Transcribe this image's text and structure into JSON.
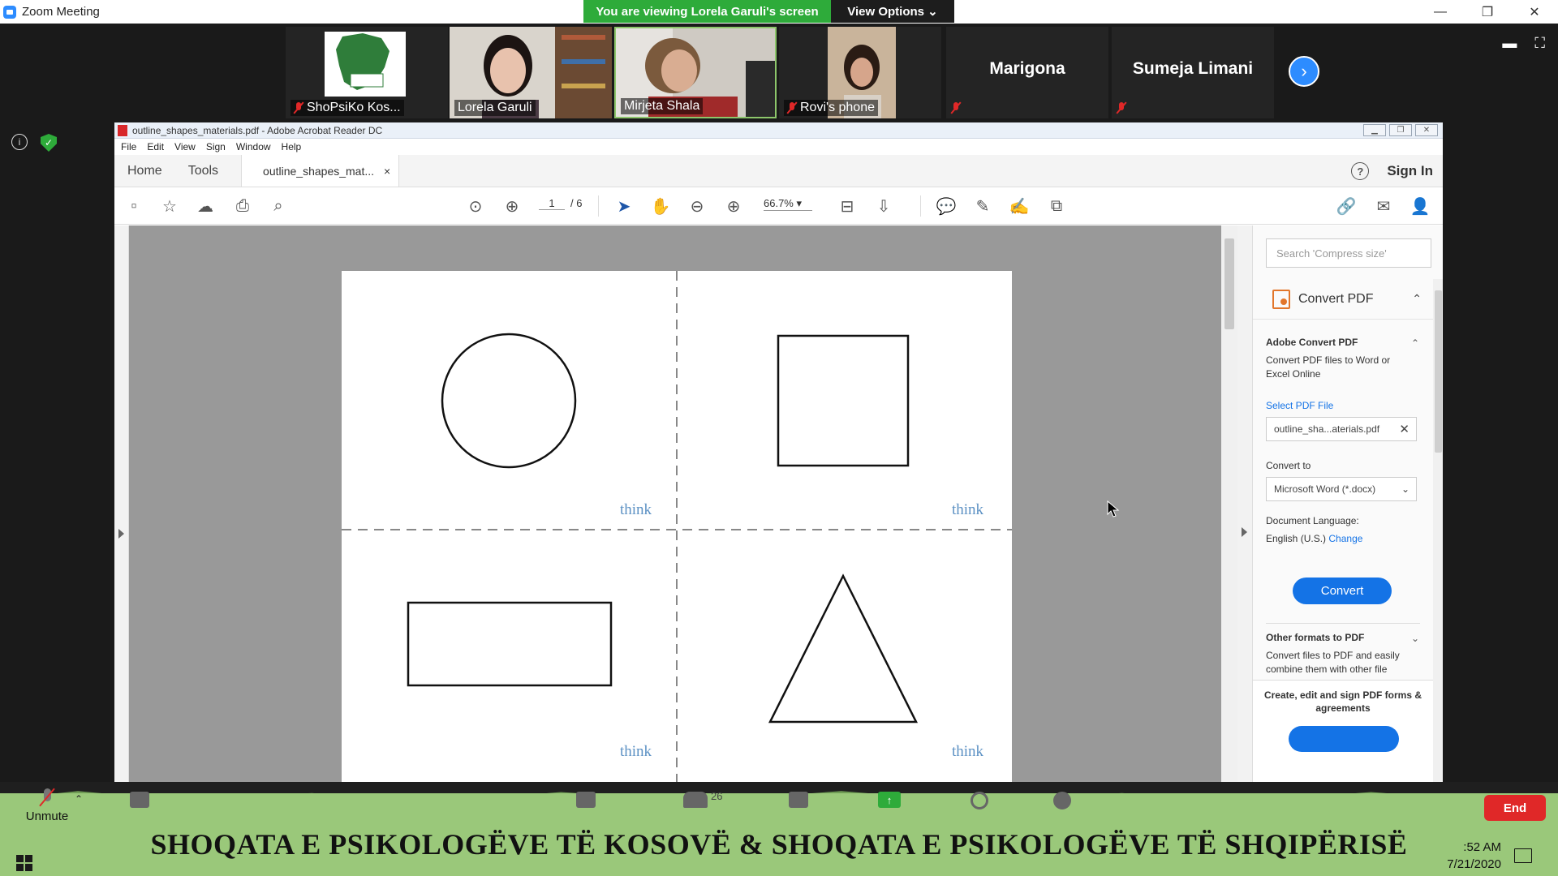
{
  "zoom": {
    "title": "Zoom Meeting",
    "viewing_banner": "You are viewing Lorela Garuli's screen",
    "view_options": "View Options ⌄",
    "minimize": "—",
    "restore": "❐",
    "close": "✕"
  },
  "participants": [
    {
      "name": "ShoPsiKo Kos...",
      "muted": true
    },
    {
      "name": "Lorela Garuli",
      "muted": false
    },
    {
      "name": "Mirjeta Shala",
      "muted": false
    },
    {
      "name": "Rovi's phone",
      "muted": true
    },
    {
      "name": "Marigona",
      "muted": true
    },
    {
      "name": "Sumeja Limani",
      "muted": true
    }
  ],
  "strip": {
    "next_glyph": "›",
    "info_glyph": "i",
    "shield_glyph": "✓"
  },
  "acrobat": {
    "title": "outline_shapes_materials.pdf - Adobe Acrobat Reader DC",
    "menu": [
      "File",
      "Edit",
      "View",
      "Sign",
      "Window",
      "Help"
    ],
    "tabs": {
      "home": "Home",
      "tools": "Tools",
      "doc": "outline_shapes_mat...",
      "doc_close": "×"
    },
    "help": "?",
    "sign_in": "Sign In",
    "toolbar": {
      "page_current": "1",
      "page_total": "/ 6",
      "zoom": "66.7%"
    },
    "watermark": "think",
    "right_pane": {
      "search_placeholder": "Search 'Compress size'",
      "convert_pdf": "Convert PDF",
      "adobe_convert": "Adobe Convert PDF",
      "adobe_convert_desc": "Convert PDF files to Word or Excel Online",
      "select_file": "Select PDF File",
      "file_name": "outline_sha...aterials.pdf",
      "convert_to": "Convert to",
      "format": "Microsoft Word (*.docx)",
      "doc_language_label": "Document Language:",
      "doc_language": "English (U.S.)",
      "change": "Change",
      "convert_button": "Convert",
      "other_formats": "Other formats to PDF",
      "other_formats_desc": "Convert files to PDF and easily combine them with other file types",
      "promo": "Create, edit and sign PDF forms & agreements"
    }
  },
  "bottom": {
    "unmute": "Unmute",
    "participants_count": "26",
    "end": "End",
    "banner": "SHOQATA E PSIKOLOGËVE TË KOSOVË & SHOQATA E PSIKOLOGËVE TË SHQIPËRISË",
    "time": ":52 AM",
    "date": "7/21/2020"
  }
}
